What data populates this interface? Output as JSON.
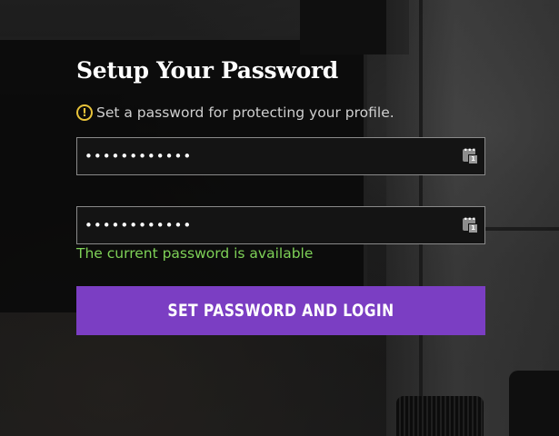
{
  "form": {
    "title": "Setup Your Password",
    "hint_icon": "warning-circle-icon",
    "hint_text": "Set a password for protecting your profile.",
    "password_value": "••••••••••••",
    "confirm_value": "••••••••••••",
    "password_manager_icon": "password-manager-icon",
    "password_manager_badge": "1",
    "status_text": "The current password is available",
    "submit_label": "SET PASSWORD AND LOGIN"
  },
  "colors": {
    "accent": "#7b3ec3",
    "status": "#7ed157",
    "warning": "#e8c33a"
  }
}
